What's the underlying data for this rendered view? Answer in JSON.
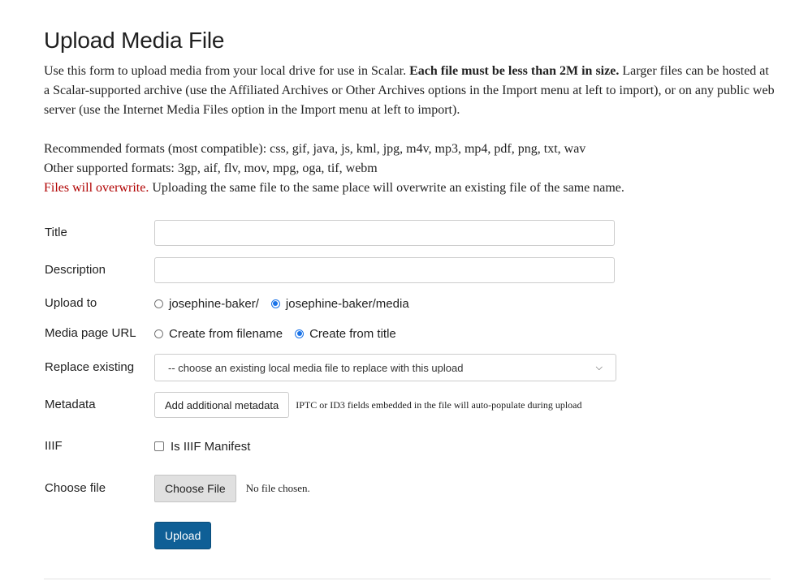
{
  "page": {
    "title": "Upload Media File",
    "intro_start": "Use this form to upload media from your local drive for use in Scalar. ",
    "intro_bold": "Each file must be less than 2M in size.",
    "intro_end": " Larger files can be hosted at a Scalar-supported archive (use the Affiliated Archives or Other Archives options in the Import menu at left to import), or on any public web server (use the Internet Media Files option in the Import menu at left to import).",
    "recommended_formats": "Recommended formats (most compatible): css, gif, java, js, kml, jpg, m4v, mp3, mp4, pdf, png, txt, wav",
    "other_formats": "Other supported formats: 3gp, aif, flv, mov, mpg, oga, tif, webm",
    "warning_red": "Files will overwrite.",
    "warning_rest": " Uploading the same file to the same place will overwrite an existing file of the same name."
  },
  "form": {
    "title_label": "Title",
    "title_value": "",
    "description_label": "Description",
    "description_value": "",
    "upload_to_label": "Upload to",
    "upload_to_options": [
      "josephine-baker/",
      "josephine-baker/media"
    ],
    "upload_to_selected": "josephine-baker/media",
    "media_url_label": "Media page URL",
    "media_url_options": [
      "Create from filename",
      "Create from title"
    ],
    "media_url_selected": "Create from title",
    "replace_label": "Replace existing",
    "replace_selected": "-- choose an existing local media file to replace with this upload",
    "metadata_label": "Metadata",
    "metadata_button": "Add additional metadata",
    "metadata_note": "IPTC or ID3 fields embedded in the file will auto-populate during upload",
    "iiif_label": "IIIF",
    "iiif_checkbox_label": "Is IIIF Manifest",
    "iiif_checked": false,
    "choose_file_label": "Choose file",
    "choose_file_button": "Choose File",
    "file_status": "No file chosen.",
    "upload_button": "Upload"
  },
  "colors": {
    "warning": "#b00000",
    "primary_button": "#0f5f96",
    "radio_selected": "#1a73e8"
  }
}
